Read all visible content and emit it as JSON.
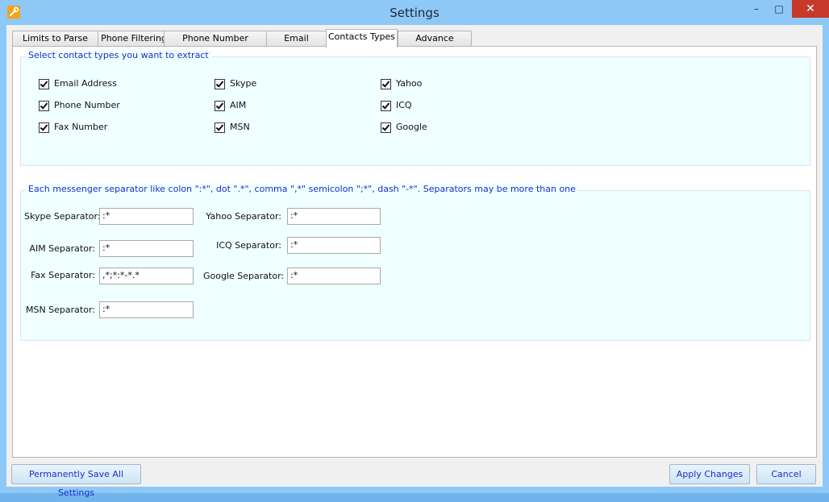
{
  "window": {
    "title": "Settings",
    "minimize": "–",
    "maximize": "□",
    "close": "✕"
  },
  "tabs": [
    "Limits to Parse URL",
    "Phone Filtering",
    "Phone Number Validator",
    "Email Filtering",
    "Contacts Types",
    "Advance Settings"
  ],
  "active_tab": "Contacts Types",
  "contact_types": {
    "legend": "Select contact types you want to extract",
    "items": [
      {
        "label": "Email Address",
        "checked": true
      },
      {
        "label": "Phone Number",
        "checked": true
      },
      {
        "label": "Fax Number",
        "checked": true
      },
      {
        "label": "Skype",
        "checked": true
      },
      {
        "label": "AIM",
        "checked": true
      },
      {
        "label": "MSN",
        "checked": true
      },
      {
        "label": "Yahoo",
        "checked": true
      },
      {
        "label": "ICQ",
        "checked": true
      },
      {
        "label": "Google",
        "checked": true
      }
    ]
  },
  "separators": {
    "legend": "Each messenger separator like colon \":*\", dot \".*\", comma \",*\" semicolon \";*\", dash \"-*\". Separators may be more than one",
    "skype": {
      "label": "Skype Separator:",
      "value": ":*"
    },
    "aim": {
      "label": "AIM Separator:",
      "value": ":*"
    },
    "fax": {
      "label": "Fax Separator:",
      "value": ",*;*:*-*.*"
    },
    "msn": {
      "label": "MSN Separator:",
      "value": ":*"
    },
    "yahoo": {
      "label": "Yahoo Separator:",
      "value": ":*"
    },
    "icq": {
      "label": "ICQ Separator:",
      "value": ":*"
    },
    "google": {
      "label": "Google Separator:",
      "value": ":*"
    }
  },
  "footer": {
    "save_all": "Permanently Save All Settings",
    "apply": "Apply Changes",
    "cancel": "Cancel"
  },
  "colors": {
    "titlebar": "#8ec8f6",
    "group_bg": "#f0ffff",
    "legend_text": "#1a2dcc",
    "close": "#c7392b"
  },
  "icons": {
    "app": "wrench-icon",
    "check": "checkmark-icon"
  }
}
